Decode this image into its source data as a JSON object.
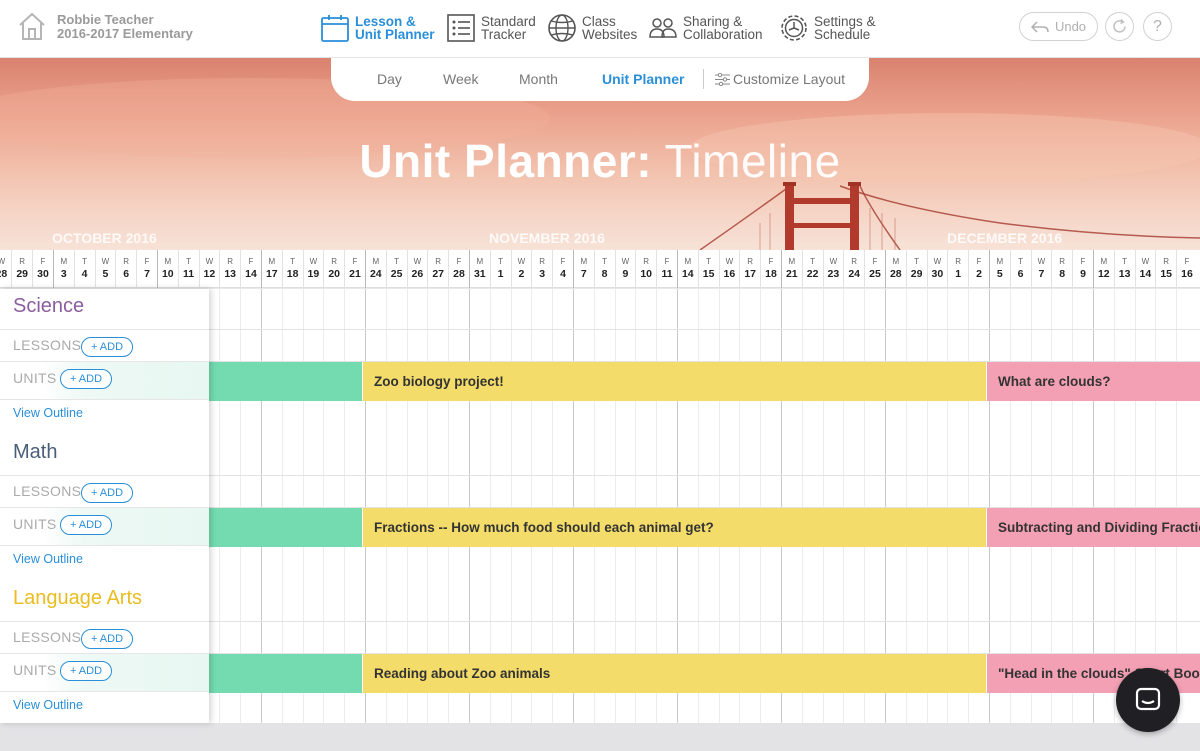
{
  "user": {
    "name": "Robbie Teacher",
    "school": "2016-2017 Elementary"
  },
  "nav": [
    {
      "id": "lesson",
      "label": "Lesson &\nUnit Planner",
      "icon": "calendar-icon",
      "active": true
    },
    {
      "id": "standard",
      "label": "Standard\nTracker",
      "icon": "checklist-icon",
      "active": false
    },
    {
      "id": "class",
      "label": "Class\nWebsites",
      "icon": "globe-icon",
      "active": false
    },
    {
      "id": "sharing",
      "label": "Sharing &\nCollaboration",
      "icon": "people-icon",
      "active": false
    },
    {
      "id": "settings",
      "label": "Settings &\nSchedule",
      "icon": "gear-icon",
      "active": false
    }
  ],
  "actions": {
    "undo_label": "Undo",
    "help_label": "?"
  },
  "view_tabs": {
    "day": "Day",
    "week": "Week",
    "month": "Month",
    "unit_planner": "Unit Planner",
    "customize": "Customize Layout"
  },
  "hero": {
    "title_strong": "Unit Planner:",
    "title_light": "Timeline"
  },
  "months": {
    "october": "OCTOBER 2016",
    "november": "NOVEMBER 2016",
    "december": "DECEMBER 2016"
  },
  "days": [
    [
      "W",
      "28"
    ],
    [
      "R",
      "29"
    ],
    [
      "F",
      "30"
    ],
    [
      "M",
      "3"
    ],
    [
      "T",
      "4"
    ],
    [
      "W",
      "5"
    ],
    [
      "R",
      "6"
    ],
    [
      "F",
      "7"
    ],
    [
      "M",
      "10"
    ],
    [
      "T",
      "11"
    ],
    [
      "W",
      "12"
    ],
    [
      "R",
      "13"
    ],
    [
      "F",
      "14"
    ],
    [
      "M",
      "17"
    ],
    [
      "T",
      "18"
    ],
    [
      "W",
      "19"
    ],
    [
      "R",
      "20"
    ],
    [
      "F",
      "21"
    ],
    [
      "M",
      "24"
    ],
    [
      "T",
      "25"
    ],
    [
      "W",
      "26"
    ],
    [
      "R",
      "27"
    ],
    [
      "F",
      "28"
    ],
    [
      "M",
      "31"
    ],
    [
      "T",
      "1"
    ],
    [
      "W",
      "2"
    ],
    [
      "R",
      "3"
    ],
    [
      "F",
      "4"
    ],
    [
      "M",
      "7"
    ],
    [
      "T",
      "8"
    ],
    [
      "W",
      "9"
    ],
    [
      "R",
      "10"
    ],
    [
      "F",
      "11"
    ],
    [
      "M",
      "14"
    ],
    [
      "T",
      "15"
    ],
    [
      "W",
      "16"
    ],
    [
      "R",
      "17"
    ],
    [
      "F",
      "18"
    ],
    [
      "M",
      "21"
    ],
    [
      "T",
      "22"
    ],
    [
      "W",
      "23"
    ],
    [
      "R",
      "24"
    ],
    [
      "F",
      "25"
    ],
    [
      "M",
      "28"
    ],
    [
      "T",
      "29"
    ],
    [
      "W",
      "30"
    ],
    [
      "R",
      "1"
    ],
    [
      "F",
      "2"
    ],
    [
      "M",
      "5"
    ],
    [
      "T",
      "6"
    ],
    [
      "W",
      "7"
    ],
    [
      "R",
      "8"
    ],
    [
      "F",
      "9"
    ],
    [
      "M",
      "12"
    ],
    [
      "T",
      "13"
    ],
    [
      "W",
      "14"
    ],
    [
      "R",
      "15"
    ],
    [
      "F",
      "16"
    ]
  ],
  "subjects": [
    {
      "name": "Science",
      "color": "#8a5e9e",
      "lessons_label": "LESSONS",
      "units_label": "UNITS",
      "add_label": "+ ADD",
      "outline_label": "View Outline",
      "units": [
        {
          "title": "",
          "color": "#74dbb0"
        },
        {
          "title": "Zoo biology project!",
          "color": "#f3dc6a"
        },
        {
          "title": "What are clouds?",
          "color": "#f4a0b4"
        }
      ]
    },
    {
      "name": "Math",
      "color": "#4a5e7a",
      "lessons_label": "LESSONS",
      "units_label": "UNITS",
      "add_label": "+ ADD",
      "outline_label": "View Outline",
      "units": [
        {
          "title": "",
          "color": "#74dbb0"
        },
        {
          "title": "Fractions -- How much food should each animal get?",
          "color": "#f3dc6a"
        },
        {
          "title": "Subtracting and Dividing Fractions",
          "color": "#f4a0b4"
        }
      ]
    },
    {
      "name": "Language Arts",
      "color": "#e9bd1f",
      "lessons_label": "LESSONS",
      "units_label": "UNITS",
      "add_label": "+ ADD",
      "outline_label": "View Outline",
      "units": [
        {
          "title": "",
          "color": "#74dbb0"
        },
        {
          "title": "Reading about Zoo animals",
          "color": "#f3dc6a"
        },
        {
          "title": "\"Head in the clouds\" Short Book",
          "color": "#f4a0b4"
        }
      ]
    }
  ],
  "colors": {
    "accent": "#2a8fd9"
  }
}
